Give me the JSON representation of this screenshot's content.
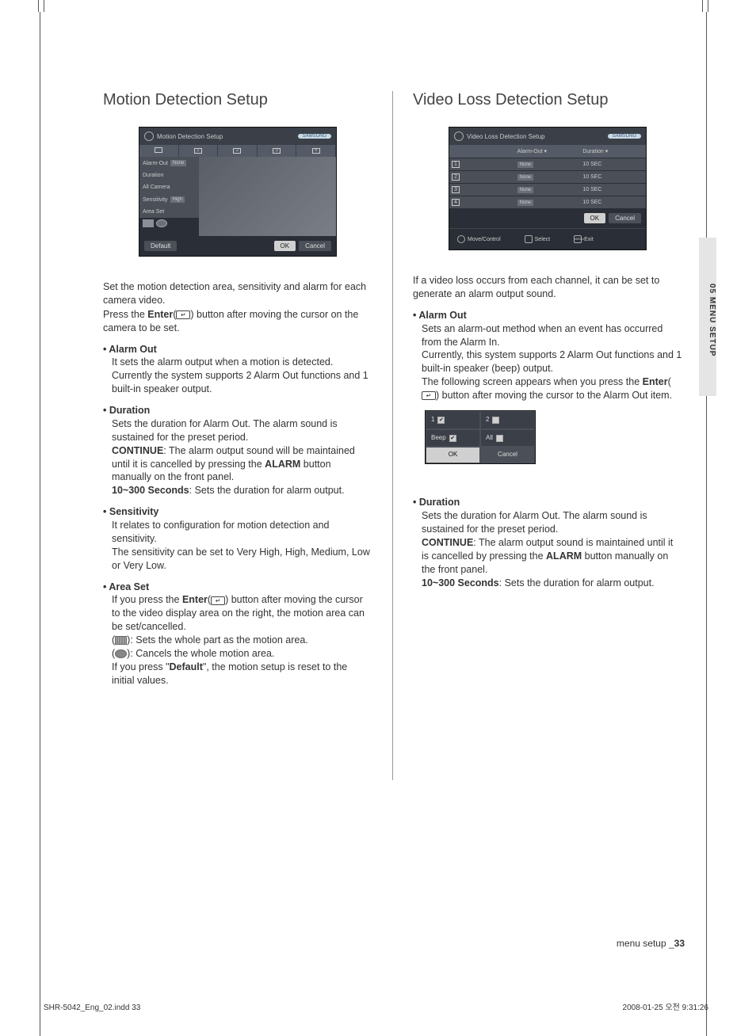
{
  "sidetab": "05 MENU SETUP",
  "enter_label": "Enter",
  "enter_icon": "↵",
  "left": {
    "title": "Motion Detection Setup",
    "screenshot": {
      "title": "Motion Detection Setup",
      "logo": "SAMSUNG",
      "tabs": [
        "",
        "1",
        "2",
        "3",
        "4"
      ],
      "side_rows": {
        "alarm_out": "Alarm-Out",
        "alarm_out_val": "None",
        "duration": "Duration",
        "all_camera": "All Camera",
        "sensitivity": "Sensitivity",
        "sensitivity_val": "High",
        "area_set": "Area Set"
      },
      "buttons": {
        "default": "Default",
        "ok": "OK",
        "cancel": "Cancel"
      }
    },
    "intro_1": "Set the motion detection area, sensitivity and alarm for each camera video.",
    "intro_2a": "Press the ",
    "intro_2b": ") button after moving the cursor on the camera to be set.",
    "bullets": {
      "alarm_out": {
        "head": "Alarm Out",
        "body": "It sets the alarm output when a motion is detected. Currently the system supports 2 Alarm Out functions and 1 built-in speaker output."
      },
      "duration": {
        "head": "Duration",
        "l1": "Sets the duration for Alarm Out. The alarm sound is sustained for the preset period.",
        "l2a": "CONTINUE",
        "l2b": ": The alarm output sound will be maintained until it is cancelled by pressing the ",
        "l2c": "ALARM",
        "l2d": " button manually on the front panel.",
        "l3a": "10~300 Seconds",
        "l3b": ": Sets the duration for alarm output."
      },
      "sensitivity": {
        "head": "Sensitivity",
        "l1": "It relates to configuration for motion detection and sensitivity.",
        "l2": "The sensitivity can be set to Very High, High, Medium, Low or Very Low."
      },
      "area_set": {
        "head": "Area Set",
        "l1a": "If you press the ",
        "l1b": ") button after moving the cursor to the video display area on the right, the motion area can be set/cancelled.",
        "l2": "): Sets the whole part as the motion area.",
        "l3": "): Cancels the whole motion area.",
        "l4a": "If you press \"",
        "l4b": "Default",
        "l4c": "\", the motion setup is reset to the initial values."
      }
    }
  },
  "right": {
    "title": "Video Loss Detection Setup",
    "screenshot": {
      "title": "Video Loss Detection Setup",
      "logo": "SAMSUNG",
      "headers": {
        "cam": "",
        "alarm": "Alarm-Out ▾",
        "duration": "Duration ▾"
      },
      "rows": [
        {
          "cam": "1",
          "alarm": "None",
          "duration": "10 SEC"
        },
        {
          "cam": "2",
          "alarm": "None",
          "duration": "10 SEC"
        },
        {
          "cam": "3",
          "alarm": "None",
          "duration": "10 SEC"
        },
        {
          "cam": "4",
          "alarm": "None",
          "duration": "10 SEC"
        }
      ],
      "buttons": {
        "ok": "OK",
        "cancel": "Cancel"
      },
      "hints": {
        "move": "Move/Control",
        "select": "Select",
        "exit": "Exit",
        "exit_key": "MENU"
      }
    },
    "intro": "If a video loss occurs from each channel, it can be set to generate an alarm output sound.",
    "bullets": {
      "alarm_out": {
        "head": "Alarm Out",
        "l1": "Sets an alarm-out method when an event has occurred from the Alarm In.",
        "l2": "Currently, this system supports 2 Alarm Out functions and 1 built-in speaker (beep) output.",
        "l3a": "The following screen appears when you press the ",
        "l3b": ") button after moving the cursor to the Alarm Out item."
      },
      "duration": {
        "head": "Duration",
        "l1": "Sets the duration for Alarm Out. The alarm sound is sustained for the preset period.",
        "l2a": "CONTINUE",
        "l2b": ": The alarm output sound is maintained until it is cancelled by pressing the ",
        "l2c": "ALARM",
        "l2d": " button manually on the front panel.",
        "l3a": "10~300 Seconds",
        "l3b": ": Sets the duration for alarm output."
      }
    },
    "popup": {
      "r1a": "1",
      "r1b": "2",
      "r2a": "Beep",
      "r2b": "All",
      "ok": "OK",
      "cancel": "Cancel"
    }
  },
  "page_label_prefix": "menu setup _",
  "page_number": "33",
  "footer_left": "SHR-5042_Eng_02.indd   33",
  "footer_right": "2008-01-25   오전 9:31:26"
}
